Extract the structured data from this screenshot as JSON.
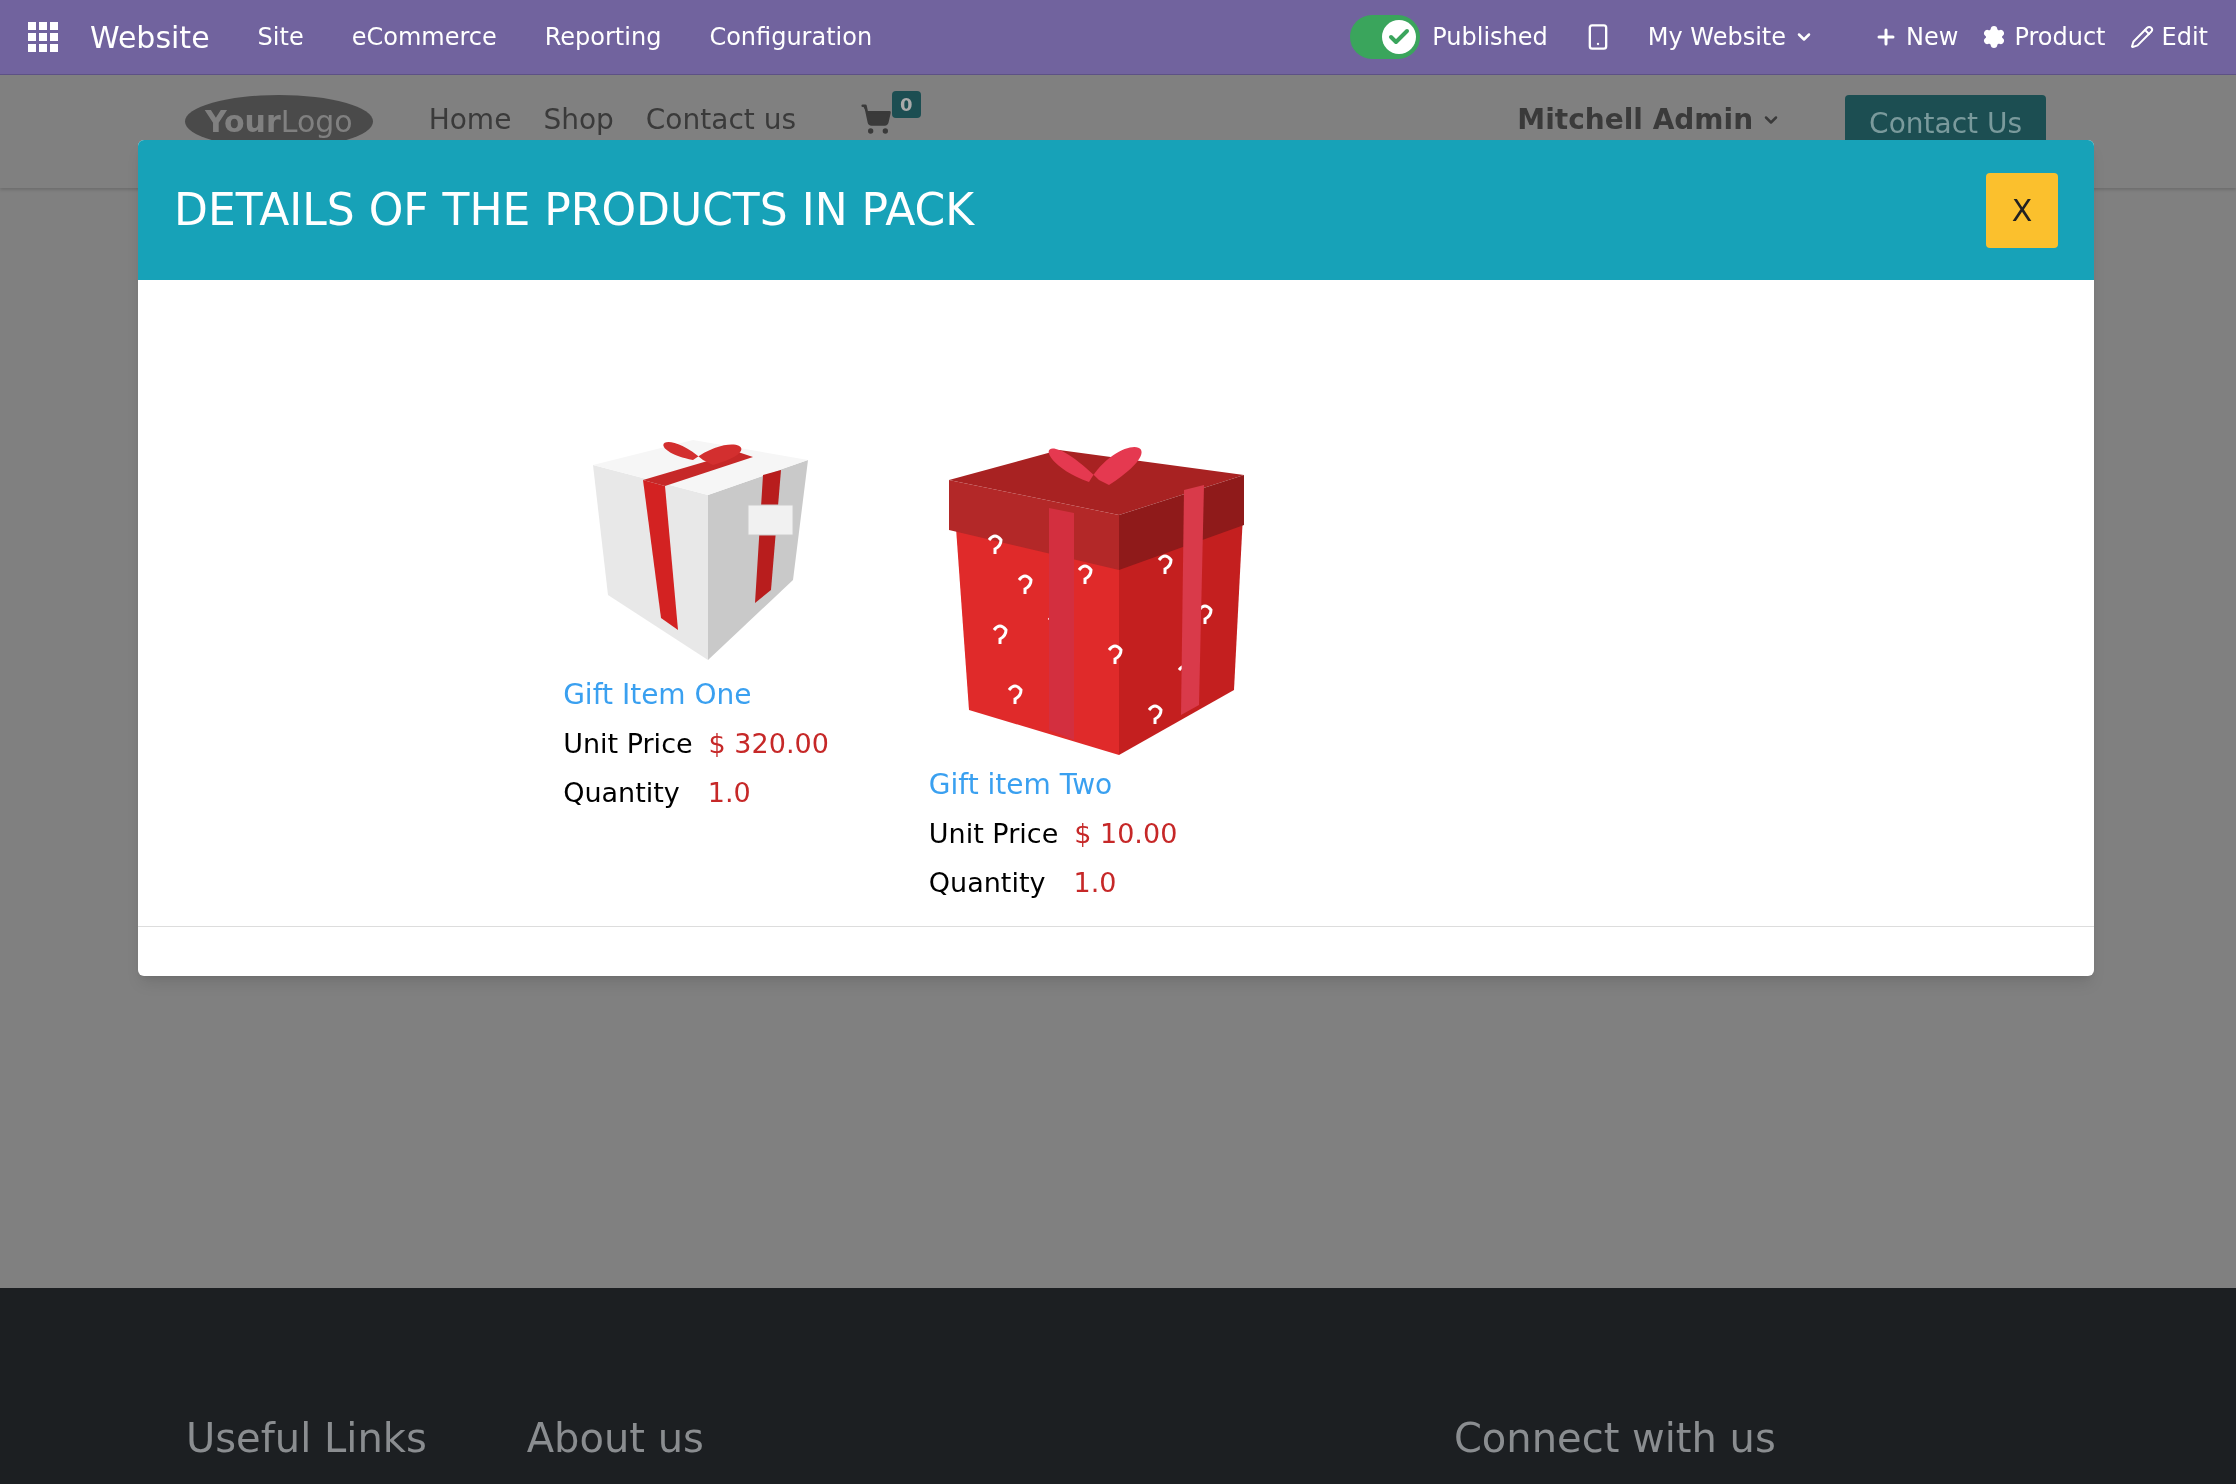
{
  "navbar": {
    "app_name": "Website",
    "menus": [
      "Site",
      "eCommerce",
      "Reporting",
      "Configuration"
    ],
    "published": {
      "label": "Published",
      "on": true
    },
    "website_switcher": "My Website",
    "actions": [
      {
        "kind": "new",
        "label": "New"
      },
      {
        "kind": "product",
        "label": "Product"
      },
      {
        "kind": "edit",
        "label": "Edit"
      }
    ]
  },
  "site_header": {
    "logo": "**Your**Logo",
    "links": [
      "Home",
      "Shop",
      "Contact us"
    ],
    "cart_count": "0",
    "user": "Mitchell Admin",
    "cta": "Contact Us"
  },
  "modal": {
    "title": "DETAILS OF THE PRODUCTS IN PACK",
    "close": "X",
    "products": [
      {
        "kind": "white",
        "name": "Gift Item One",
        "price_label": "Unit Price",
        "price": "$ 320.00",
        "quantity_label": "Quantity",
        "quantity": "1.0"
      },
      {
        "kind": "red",
        "name": "Gift item Two",
        "price_label": "Unit Price",
        "price": "$ 10.00",
        "quantity_label": "Quantity",
        "quantity": "1.0"
      }
    ]
  },
  "footer": {
    "headings": [
      "Useful Links",
      "About us",
      "Connect with us"
    ]
  }
}
